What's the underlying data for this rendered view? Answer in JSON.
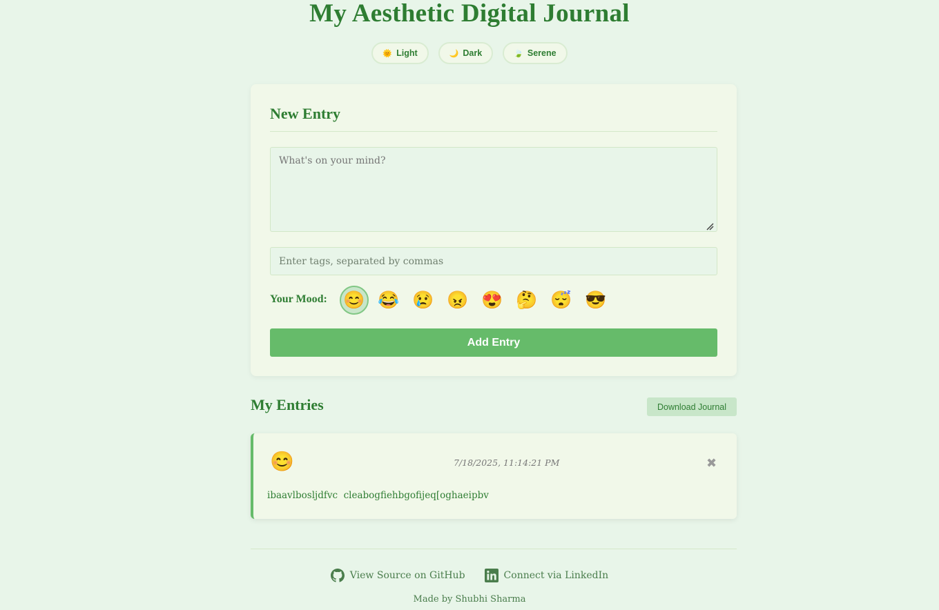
{
  "header": {
    "title": "My Aesthetic Digital Journal"
  },
  "themes": [
    {
      "icon": "sun-icon",
      "glyph": "🌞",
      "label": "Light"
    },
    {
      "icon": "moon-icon",
      "glyph": "🌙",
      "label": "Dark"
    },
    {
      "icon": "leaf-icon",
      "glyph": "🍃",
      "label": "Serene"
    }
  ],
  "new_entry": {
    "title": "New Entry",
    "textarea_placeholder": "What's on your mind?",
    "tags_placeholder": "Enter tags, separated by commas",
    "mood_label": "Your Mood:",
    "moods": [
      "😊",
      "😂",
      "😢",
      "😠",
      "😍",
      "🤔",
      "😴",
      "😎"
    ],
    "selected_mood_index": 0,
    "add_button": "Add Entry"
  },
  "entries_section": {
    "title": "My Entries",
    "download_button": "Download Journal",
    "entries": [
      {
        "mood": "😊",
        "date": "7/18/2025, 11:14:21 PM",
        "delete_glyph": "✖",
        "text": "ibaavlbosljdfvc  cleabogfiehbgofijeq[oghaeipbv"
      }
    ]
  },
  "footer": {
    "github_label": "View Source on GitHub",
    "linkedin_label": "Connect via LinkedIn",
    "made_by": "Made by Shubhi Sharma"
  },
  "colors": {
    "background": "#e8f5e9",
    "primary": "#2e7d32",
    "accent": "#66bb6a",
    "card": "#f1f8e9"
  }
}
